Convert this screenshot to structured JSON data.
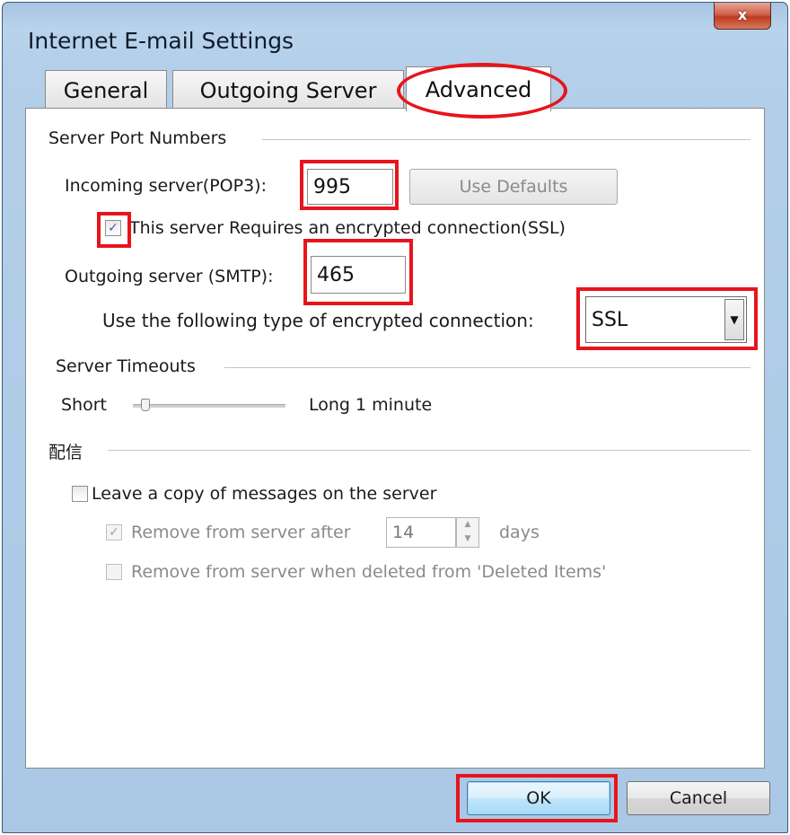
{
  "window": {
    "title": "Internet E-mail Settings",
    "close_glyph": "x"
  },
  "tabs": [
    {
      "label": "General"
    },
    {
      "label": "Outgoing Server"
    },
    {
      "label": "Advanced"
    }
  ],
  "active_tab": "Advanced",
  "ports": {
    "group_label": "Server Port Numbers",
    "incoming_label": "Incoming server(POP3):",
    "incoming_value": "995",
    "use_defaults_label": "Use Defaults",
    "ssl_checkbox_label": "This server Requires an encrypted connection(SSL)",
    "ssl_checked": true,
    "outgoing_label": "Outgoing server (SMTP):",
    "outgoing_value": "465",
    "encryption_label": "Use the following type of encrypted connection:",
    "encryption_value": "SSL"
  },
  "timeouts": {
    "group_label": "Server Timeouts",
    "short_label": "Short",
    "long_label": "Long 1 minute",
    "slider_level": 0.08
  },
  "delivery": {
    "group_label": "配信",
    "leave_copy_label": "Leave a copy of messages on the server",
    "leave_copy_checked": false,
    "remove_after_label": "Remove from server after",
    "remove_after_checked": true,
    "remove_after_days": "14",
    "days_label": "days",
    "remove_deleted_label": "Remove from server when deleted from 'Deleted Items'",
    "remove_deleted_checked": false
  },
  "buttons": {
    "ok": "OK",
    "cancel": "Cancel"
  },
  "icons": {
    "checkbox_check": "✓",
    "dropdown_arrow": "▼",
    "spin_up": "▲",
    "spin_down": "▼"
  },
  "colors": {
    "annotation": "#e8141c",
    "title_bar": "#b3cfe9",
    "close_button": "#c8462d"
  }
}
